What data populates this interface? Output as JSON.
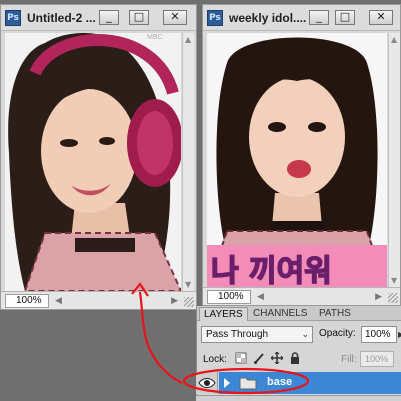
{
  "left_window": {
    "app_badge": "Ps",
    "title": "Untitled-2 ...",
    "zoom": "100%",
    "buttons": {
      "minimize": "_",
      "maximize": "□",
      "close": "✕"
    }
  },
  "right_window": {
    "app_badge": "Ps",
    "title": "weekly idol....",
    "zoom": "100%",
    "buttons": {
      "minimize": "_",
      "maximize": "□",
      "close": "✕"
    }
  },
  "left_photo": {
    "watermark": "MBC"
  },
  "right_photo": {
    "caption": "나 끼여워"
  },
  "layers_panel": {
    "tabs": [
      "LAYERS",
      "CHANNELS",
      "PATHS"
    ],
    "blend_mode": "Pass Through",
    "opacity_label": "Opacity:",
    "opacity_value": "100%",
    "lock_label": "Lock:",
    "fill_label": "Fill:",
    "fill_value": "100%",
    "layer": {
      "name": "base"
    }
  },
  "colors": {
    "selection": "#3b87d6",
    "annotation": "#e8141c",
    "ps_badge": "#2d5c97"
  }
}
